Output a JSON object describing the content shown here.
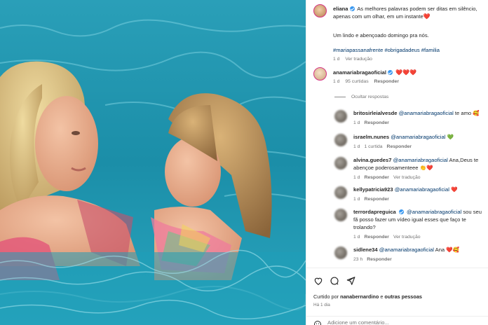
{
  "post": {
    "author": "eliana",
    "caption": "As melhores palavras podem ser ditas em silêncio, apenas com um olhar, em um instante",
    "caption_line2": "Um lindo e abençoado domingo pra nós.",
    "hashtags": "#mariapassanafrente #obrigadadeus #familia",
    "time": "1 d",
    "translate": "Ver tradução"
  },
  "comment_main": {
    "user": "anamariabragaoficial",
    "hearts": "❤️❤️❤️",
    "time": "1 d",
    "likes": "95 curtidas",
    "reply": "Responder",
    "hide_replies": "Ocultar respostas"
  },
  "replies": [
    {
      "user": "britosirleialvesde",
      "mention": "@anamariabragaoficial",
      "text": " te amo",
      "emoji": "🥰",
      "time": "1 d",
      "likes": "",
      "reply": "Responder",
      "translate": ""
    },
    {
      "user": "israelm.nunes",
      "mention": "@anamariabragaoficial",
      "text": "",
      "emoji": "💚",
      "time": "1 d",
      "likes": "1 curtida",
      "reply": "Responder",
      "translate": ""
    },
    {
      "user": "alvina.guedes7",
      "mention": "@anamariabragaoficial",
      "text": " Ana,Deus te abençoe poderosamenteee",
      "emoji": "👏❤️",
      "time": "1 d",
      "likes": "",
      "reply": "Responder",
      "translate": "Ver tradução"
    },
    {
      "user": "kellypatricia923",
      "mention": "@anamariabragaoficial",
      "text": "",
      "emoji": "❤️",
      "time": "1 d",
      "likes": "",
      "reply": "Responder",
      "translate": ""
    },
    {
      "user": "terrordapreguica",
      "mention": "@anamariabragaoficial",
      "text": " sou seu fã posso fazer um vídeo igual esses que faço te trolando?",
      "emoji": "",
      "time": "1 d",
      "likes": "",
      "reply": "Responder",
      "translate": "Ver tradução"
    },
    {
      "user": "sidlene34",
      "mention": "@anamariabragaoficial",
      "text": " Ana",
      "emoji": "❤️🥰",
      "time": "23 h",
      "likes": "",
      "reply": "Responder",
      "translate": ""
    }
  ],
  "actions": {
    "liked_prefix": "Curtido por",
    "liked_user": "nanabernardino",
    "liked_and": "e",
    "liked_others": "outras pessoas",
    "date": "Há 1 dia",
    "add_comment_placeholder": "Adicione um comentário..."
  },
  "colors": {
    "verified": "#3797f0",
    "link": "#00376b",
    "heart": "#ed2b2b",
    "pool": "#1f9fb8"
  }
}
